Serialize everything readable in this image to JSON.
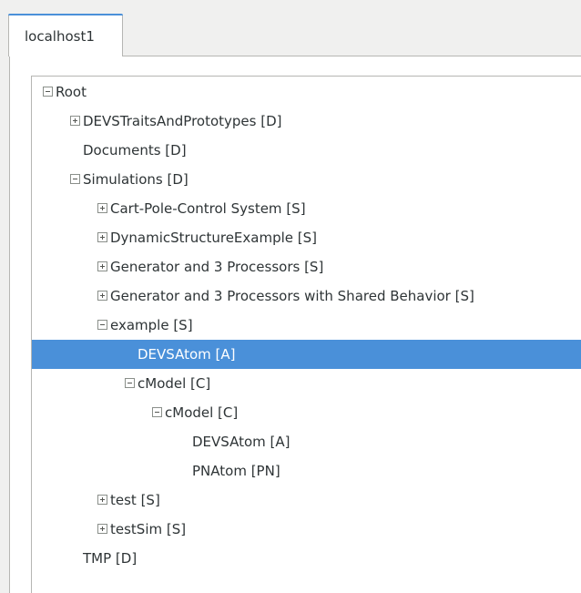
{
  "tab": {
    "label": "localhost1"
  },
  "tree": {
    "nodes": [
      {
        "label": "Root",
        "depth": 0,
        "expander": "minus"
      },
      {
        "label": "DEVSTraitsAndPrototypes [D]",
        "depth": 1,
        "expander": "plus"
      },
      {
        "label": "Documents [D]",
        "depth": 1,
        "expander": "none"
      },
      {
        "label": "Simulations [D]",
        "depth": 1,
        "expander": "minus"
      },
      {
        "label": "Cart-Pole-Control System [S]",
        "depth": 2,
        "expander": "plus"
      },
      {
        "label": "DynamicStructureExample [S]",
        "depth": 2,
        "expander": "plus"
      },
      {
        "label": "Generator and 3 Processors [S]",
        "depth": 2,
        "expander": "plus"
      },
      {
        "label": "Generator and 3 Processors with Shared Behavior [S]",
        "depth": 2,
        "expander": "plus"
      },
      {
        "label": "example [S]",
        "depth": 2,
        "expander": "minus"
      },
      {
        "label": "DEVSAtom [A]",
        "depth": 3,
        "expander": "none",
        "selected": true
      },
      {
        "label": "cModel [C]",
        "depth": 3,
        "expander": "minus"
      },
      {
        "label": "cModel [C]",
        "depth": 4,
        "expander": "minus"
      },
      {
        "label": "DEVSAtom [A]",
        "depth": 5,
        "expander": "none"
      },
      {
        "label": "PNAtom [PN]",
        "depth": 5,
        "expander": "none"
      },
      {
        "label": "test [S]",
        "depth": 2,
        "expander": "plus"
      },
      {
        "label": "testSim [S]",
        "depth": 2,
        "expander": "plus"
      },
      {
        "label": "TMP [D]",
        "depth": 1,
        "expander": "none"
      }
    ]
  },
  "colors": {
    "selection": "#4a90d9",
    "tab_accent": "#4a90d9",
    "background": "#f0f0ef"
  }
}
